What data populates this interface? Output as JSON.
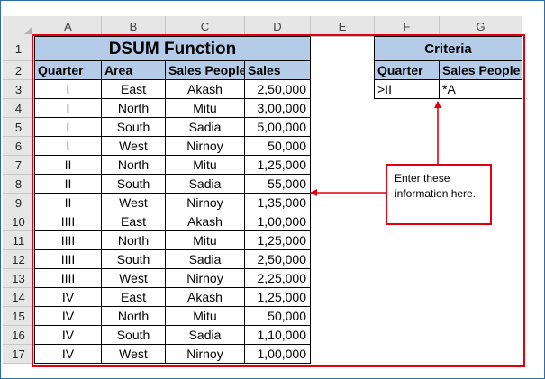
{
  "columns": [
    "A",
    "B",
    "C",
    "D",
    "E",
    "F",
    "G"
  ],
  "rows": [
    "1",
    "2",
    "3",
    "4",
    "5",
    "6",
    "7",
    "8",
    "9",
    "10",
    "11",
    "12",
    "13",
    "14",
    "15",
    "16",
    "17"
  ],
  "table": {
    "title": "DSUM Function",
    "headers": [
      "Quarter",
      "Area",
      "Sales People",
      "Sales"
    ],
    "data": [
      [
        "I",
        "East",
        "Akash",
        "2,50,000"
      ],
      [
        "I",
        "North",
        "Mitu",
        "3,00,000"
      ],
      [
        "I",
        "South",
        "Sadia",
        "5,00,000"
      ],
      [
        "I",
        "West",
        "Nirnoy",
        "50,000"
      ],
      [
        "II",
        "North",
        "Mitu",
        "1,25,000"
      ],
      [
        "II",
        "South",
        "Sadia",
        "55,000"
      ],
      [
        "II",
        "West",
        "Nirnoy",
        "1,35,000"
      ],
      [
        "IIII",
        "East",
        "Akash",
        "1,00,000"
      ],
      [
        "IIII",
        "North",
        "Mitu",
        "1,25,000"
      ],
      [
        "IIII",
        "South",
        "Sadia",
        "2,50,000"
      ],
      [
        "IIII",
        "West",
        "Nirnoy",
        "2,25,000"
      ],
      [
        "IV",
        "East",
        "Akash",
        "1,25,000"
      ],
      [
        "IV",
        "North",
        "Mitu",
        "50,000"
      ],
      [
        "IV",
        "South",
        "Sadia",
        "1,10,000"
      ],
      [
        "IV",
        "West",
        "Nirnoy",
        "1,00,000"
      ]
    ]
  },
  "criteria": {
    "title": "Criteria",
    "headers": [
      "Quarter",
      "Sales People"
    ],
    "values": [
      ">II",
      "*A"
    ]
  },
  "callout": {
    "text": "Enter these information here."
  },
  "colors": {
    "header_fill": "#b4cce8",
    "annotation_red": "#e0000f",
    "frame_border": "#2e6da4"
  }
}
